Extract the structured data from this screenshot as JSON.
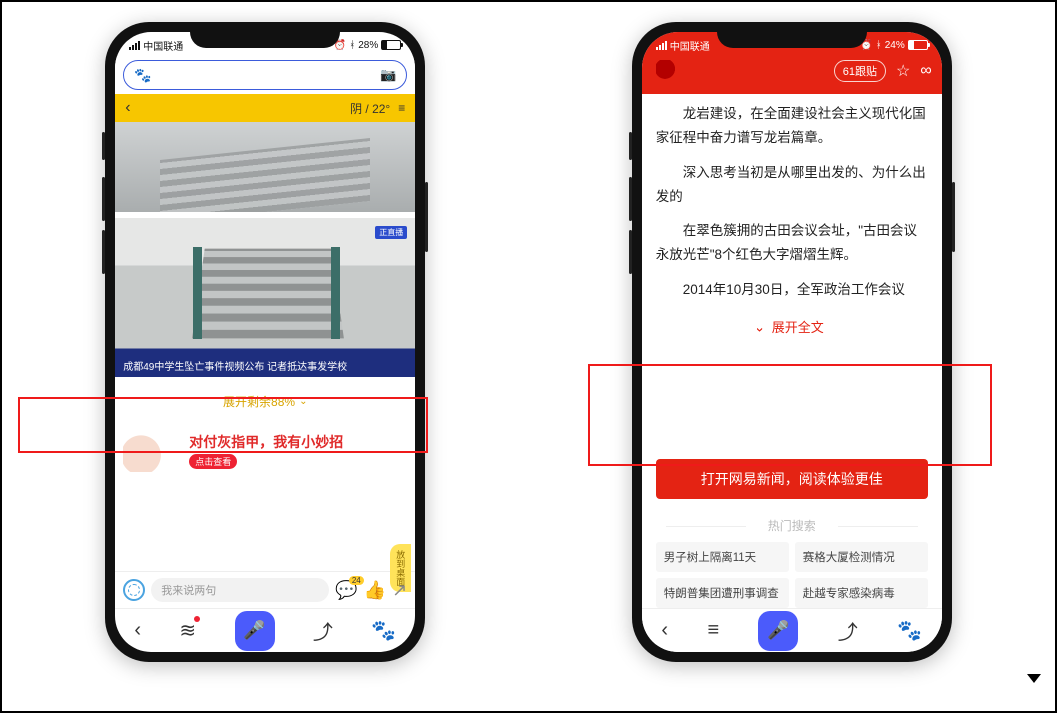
{
  "phone1": {
    "status": {
      "carrier": "中国联通",
      "battery": "28%"
    },
    "weather": "阴 / 22°",
    "video": {
      "tag": "正直播",
      "caption": "成都49中学生坠亡事件视频公布 记者抵达事发学校"
    },
    "expand": "展开剩余88%",
    "ad": {
      "text": "对付灰指甲，我有小妙招",
      "btn": "点击查看"
    },
    "desktop_pill": "放到桌面",
    "comment_placeholder": "我来说两句",
    "comment_badge": "24"
  },
  "phone2": {
    "status": {
      "carrier": "中国联通",
      "battery": "24%"
    },
    "follow": "61跟贴",
    "article": {
      "p1": "龙岩建设，在全面建设社会主义现代化国家征程中奋力谱写龙岩篇章。",
      "p2": "深入思考当初是从哪里出发的、为什么出发的",
      "p3": "在翠色簇拥的古田会议会址，\"古田会议永放光芒\"8个红色大字熠熠生辉。",
      "p4": "2014年10月30日，全军政治工作会议"
    },
    "expand": "展开全文",
    "open_app": "打开网易新闻，阅读体验更佳",
    "hot_title": "热门搜索",
    "hot": [
      "男子树上隔离11天",
      "赛格大厦检测情况",
      "特朗普集团遭刑事调查",
      "赴越专家感染病毒"
    ]
  }
}
